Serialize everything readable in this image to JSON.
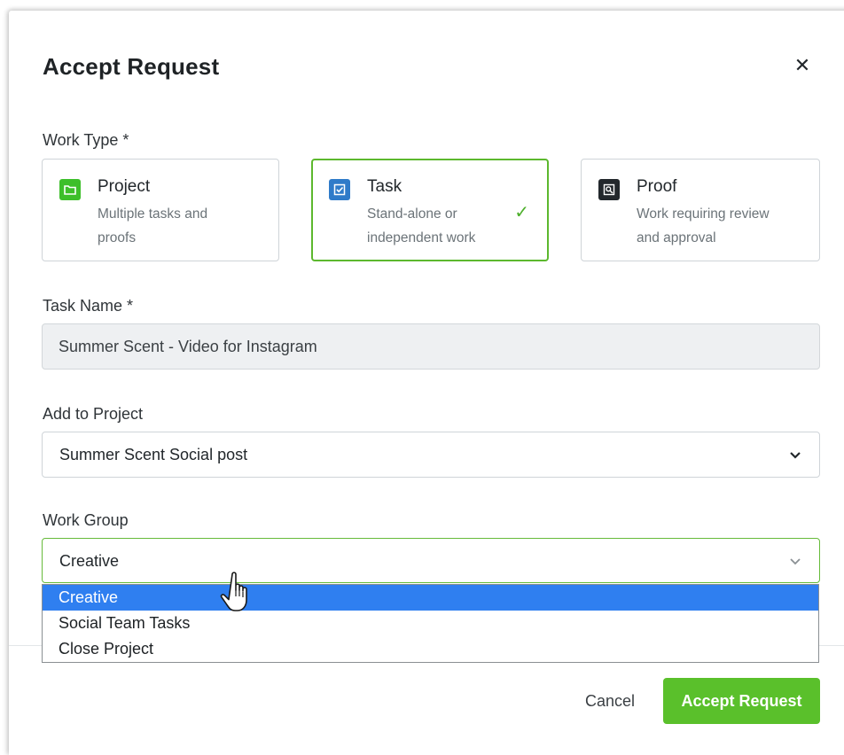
{
  "dialog": {
    "title": "Accept Request",
    "close_icon": "close-icon"
  },
  "work_type": {
    "label": "Work Type *",
    "options": [
      {
        "title": "Project",
        "desc_line1": "Multiple tasks and",
        "desc_line2": "proofs",
        "icon": "folder-icon",
        "color": "#3dbf2a",
        "selected": false
      },
      {
        "title": "Task",
        "desc_line1": "Stand-alone or",
        "desc_line2": "independent work",
        "icon": "checkbox-icon",
        "color": "#2f7bc9",
        "selected": true
      },
      {
        "title": "Proof",
        "desc_line1": "Work requiring review",
        "desc_line2": "and approval",
        "icon": "proof-search-icon",
        "color": "#23282c",
        "selected": false
      }
    ]
  },
  "task_name": {
    "label": "Task Name *",
    "value": "Summer Scent - Video for Instagram"
  },
  "add_to_project": {
    "label": "Add to Project",
    "value": "Summer Scent Social post"
  },
  "work_group": {
    "label": "Work Group",
    "value": "Creative",
    "options": [
      "Creative",
      "Social Team Tasks",
      "Close Project"
    ],
    "highlighted": "Creative"
  },
  "footer": {
    "cancel_label": "Cancel",
    "accept_label": "Accept Request"
  },
  "colors": {
    "accent_green": "#5ac02b",
    "highlight_blue": "#2f7ff0"
  }
}
